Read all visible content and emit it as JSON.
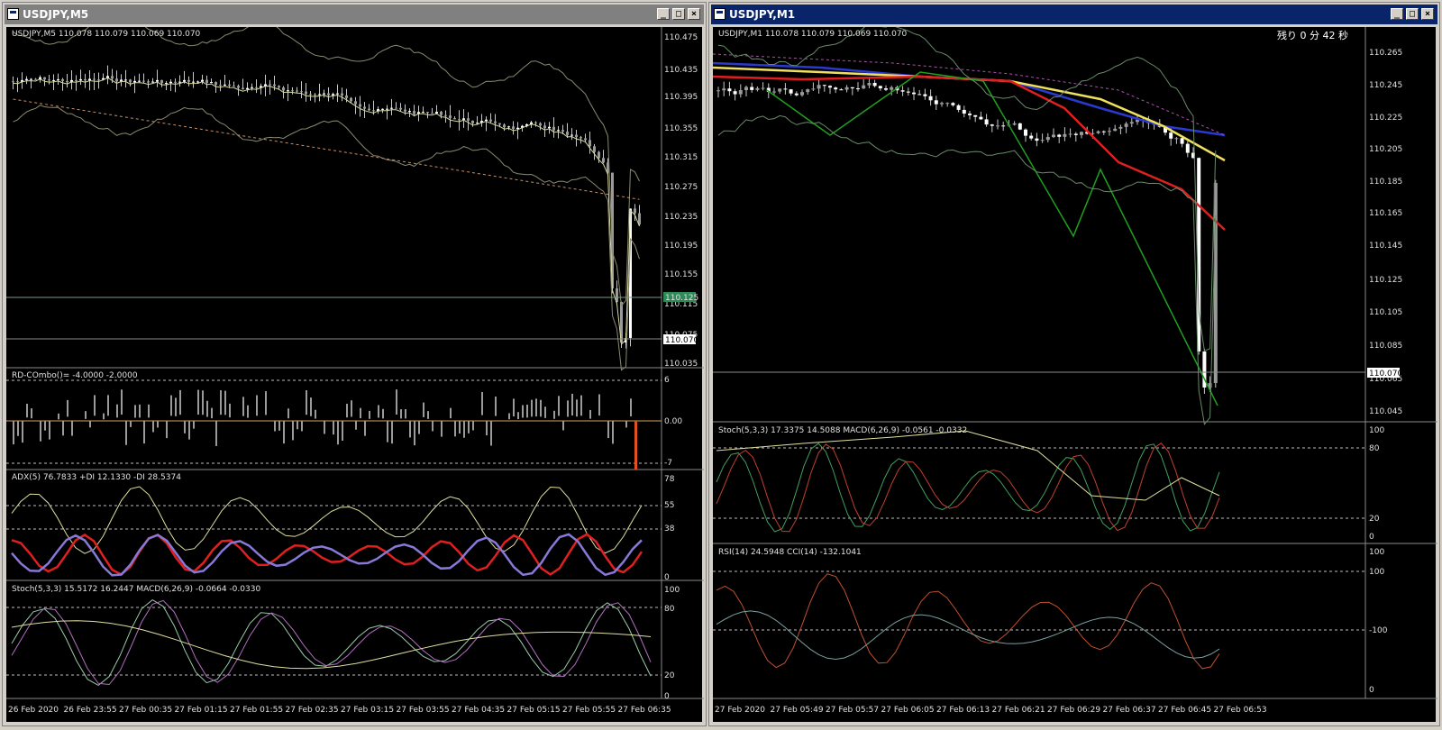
{
  "left": {
    "title": "USDJPY,M5",
    "header": "USDJPY,M5  110.078 110.079 110.069 110.070",
    "price_axis": [
      "110.475",
      "110.435",
      "110.395",
      "110.355",
      "110.315",
      "110.275",
      "110.235",
      "110.195",
      "110.155",
      "110.115",
      "110.075",
      "110.035"
    ],
    "bid_label": "110.125",
    "last_label": "110.070",
    "rd_label": "RD-COmbo()= -4.0000 -2.0000",
    "rd_axis": [
      "6",
      "0.00",
      "-7"
    ],
    "adx_label": "ADX(5) 76.7833 +DI 12.1330 -DI 28.5374",
    "adx_axis": [
      "78",
      "55",
      "38",
      "0"
    ],
    "stoch_label": "Stoch(5,3,3) 15.5172 16.2447  MACD(6,26,9) -0.0664 -0.0330",
    "stoch_axis": [
      "100",
      "80",
      "20",
      "0"
    ],
    "time_axis": [
      "26 Feb 2020",
      "26 Feb 23:55",
      "27 Feb 00:35",
      "27 Feb 01:15",
      "27 Feb 01:55",
      "27 Feb 02:35",
      "27 Feb 03:15",
      "27 Feb 03:55",
      "27 Feb 04:35",
      "27 Feb 05:15",
      "27 Feb 05:55",
      "27 Feb 06:35"
    ]
  },
  "right": {
    "title": "USDJPY,M1",
    "header": "USDJPY,M1  110.078 110.079 110.069 110.070",
    "countdown": "残り 0 分 42 秒",
    "price_axis": [
      "110.265",
      "110.245",
      "110.225",
      "110.205",
      "110.185",
      "110.165",
      "110.145",
      "110.125",
      "110.105",
      "110.085",
      "110.065",
      "110.045"
    ],
    "last_label": "110.070",
    "stoch_label": "Stoch(5,3,3) 17.3375 14.5088  MACD(6,26,9) -0.0561 -0.0332",
    "stoch_axis": [
      "100",
      "80",
      "20",
      "0"
    ],
    "rsi_label": "RSI(14) 24.5948  CCI(14) -132.1041",
    "rsi_axis": [
      "100",
      "100",
      "-100",
      "0"
    ],
    "time_axis": [
      "27 Feb 2020",
      "27 Feb 05:49",
      "27 Feb 05:57",
      "27 Feb 06:05",
      "27 Feb 06:13",
      "27 Feb 06:21",
      "27 Feb 06:29",
      "27 Feb 06:37",
      "27 Feb 06:45",
      "27 Feb 06:53"
    ]
  },
  "window_buttons": {
    "minimize": "_",
    "maximize": "□",
    "close": "×"
  }
}
